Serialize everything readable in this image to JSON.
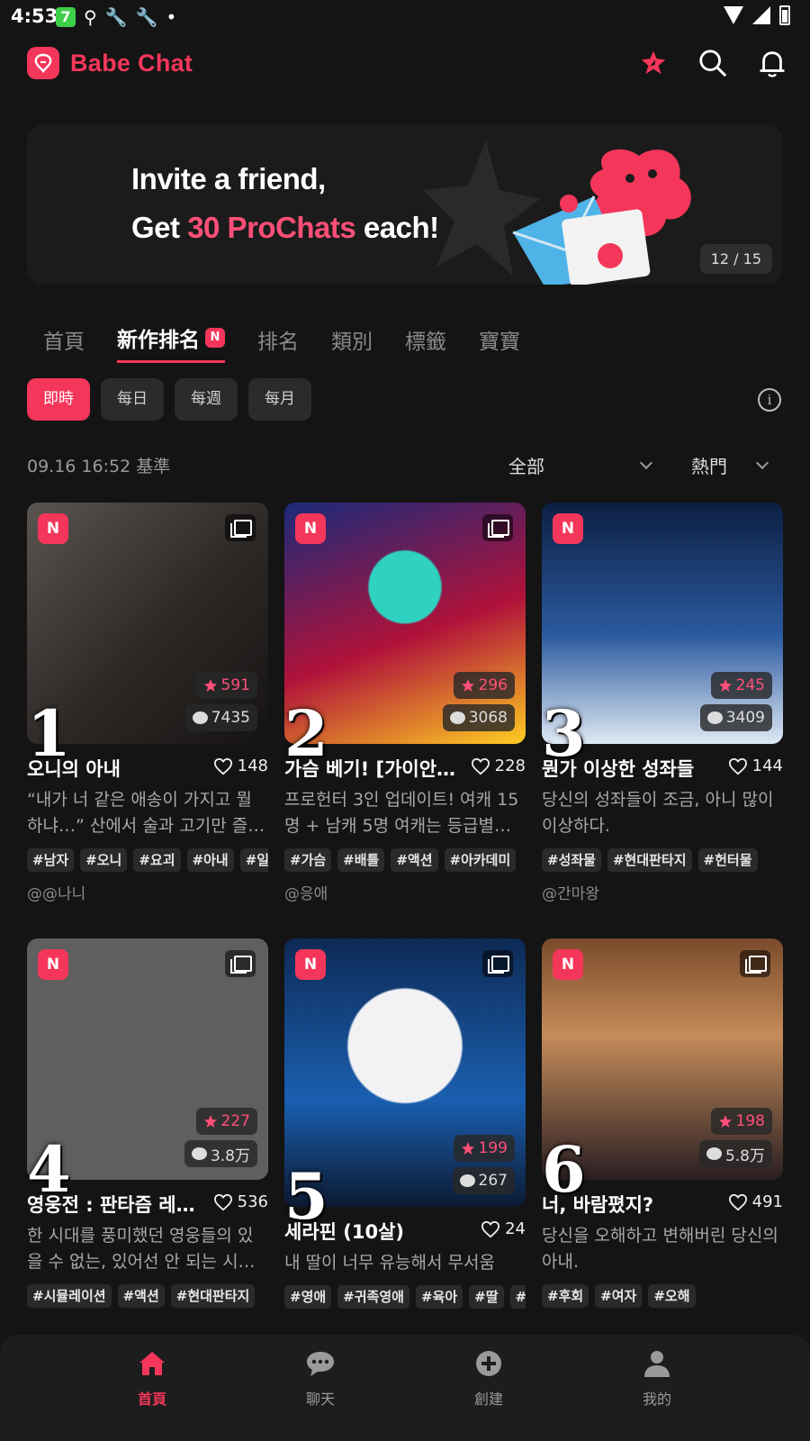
{
  "status": {
    "time": "4:53"
  },
  "app": {
    "name": "Babe Chat"
  },
  "banner": {
    "line1": "Invite a friend,",
    "line2_pre": "Get ",
    "line2_highlight": "30 ProChats",
    "line2_post": " each!",
    "pager": "12 / 15"
  },
  "tabs": [
    {
      "label": "首頁",
      "active": false
    },
    {
      "label": "新作排名",
      "active": true,
      "badge": "N"
    },
    {
      "label": "排名",
      "active": false
    },
    {
      "label": "類別",
      "active": false
    },
    {
      "label": "標籤",
      "active": false
    },
    {
      "label": "寶寶",
      "active": false
    }
  ],
  "filters": [
    "即時",
    "每日",
    "每週",
    "每月"
  ],
  "basis": "09.16 16:52 基準",
  "dropdowns": {
    "scope": "全部",
    "sort": "熱門"
  },
  "cards": [
    {
      "rank": "1",
      "badge": "N",
      "prochats": "591",
      "comments": "7435",
      "title": "오니의 아내",
      "likes": "148",
      "desc": "“내가 너 같은 애송이 가지고 뭘 하냐…” 산에서 술과 고기만 즐…",
      "tags": [
        "#남자",
        "#오니",
        "#요괴",
        "#아내",
        "#일"
      ],
      "author": "@@나니"
    },
    {
      "rank": "2",
      "badge": "N",
      "prochats": "296",
      "comments": "3068",
      "title": "가슴 베기! [가이안…",
      "likes": "228",
      "desc": "프로헌터 3인 업데이트! 여캐 15명 + 남캐 5명 여캐는 등급별로…",
      "tags": [
        "#가슴",
        "#배틀",
        "#액션",
        "#아카데미"
      ],
      "author": "@응애"
    },
    {
      "rank": "3",
      "badge": "N",
      "prochats": "245",
      "comments": "3409",
      "title": "뭔가 이상한 성좌들",
      "likes": "144",
      "desc": "당신의 성좌들이 조금, 아니 많이 이상하다.",
      "tags": [
        "#성좌물",
        "#현대판타지",
        "#헌터물"
      ],
      "author": "@간마왕"
    },
    {
      "rank": "4",
      "badge": "N",
      "prochats": "227",
      "comments": "3.8万",
      "title": "영웅전 : 판타즘 레…",
      "likes": "536",
      "desc": "한 시대를 풍미했던 영웅들의 있을 수 없는, 있어선 안 되는 시…",
      "tags": [
        "#시뮬레이션",
        "#액션",
        "#현대판타지"
      ],
      "author": ""
    },
    {
      "rank": "5",
      "badge": "N",
      "prochats": "199",
      "comments": "267",
      "title": "세라핀 (10살)",
      "likes": "24",
      "desc": "내 딸이 너무 유능해서 무서움",
      "tags": [
        "#영애",
        "#귀족영애",
        "#육아",
        "#딸",
        "#"
      ],
      "author": ""
    },
    {
      "rank": "6",
      "badge": "N",
      "prochats": "198",
      "comments": "5.8万",
      "title": "너, 바람폈지?",
      "likes": "491",
      "desc": "당신을 오해하고 변해버린 당신의 아내.",
      "tags": [
        "#후회",
        "#여자",
        "#오해"
      ],
      "author": ""
    }
  ],
  "nav": [
    {
      "label": "首頁",
      "icon": "home-icon",
      "active": true
    },
    {
      "label": "聊天",
      "icon": "chat-icon",
      "active": false
    },
    {
      "label": "創建",
      "icon": "create-icon",
      "active": false
    },
    {
      "label": "我的",
      "icon": "profile-icon",
      "active": false
    }
  ],
  "colors": {
    "accent": "#f4365a",
    "background": "#141414",
    "highlight": "#ff4f78"
  }
}
